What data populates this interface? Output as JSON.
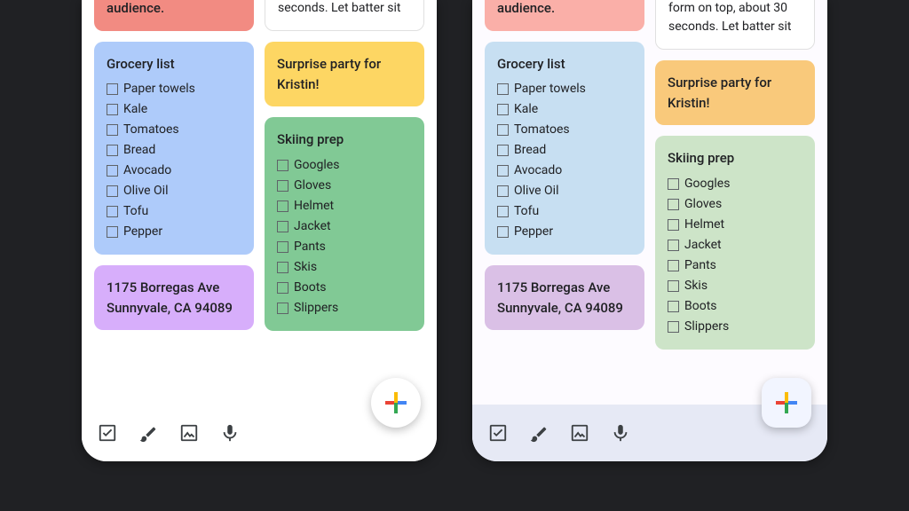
{
  "partial_coral_text": "audience.",
  "partial_white_text": "form on top, about 30 seconds. Let batter sit",
  "partial_white_text_classic": "seconds. Let batter sit",
  "grocery": {
    "title": "Grocery list",
    "items": [
      "Paper towels",
      "Kale",
      "Tomatoes",
      "Bread",
      "Avocado",
      "Olive Oil",
      "Tofu",
      "Pepper"
    ]
  },
  "address": "1175 Borregas Ave Sunnyvale, CA 94089",
  "surprise": "Surprise party for Kristin!",
  "skiing": {
    "title": "Skiing prep",
    "items": [
      "Googles",
      "Gloves",
      "Helmet",
      "Jacket",
      "Pants",
      "Skis",
      "Boots",
      "Slippers"
    ]
  },
  "toolbar_icons": [
    "checkbox-icon",
    "brush-icon",
    "image-icon",
    "mic-icon"
  ]
}
